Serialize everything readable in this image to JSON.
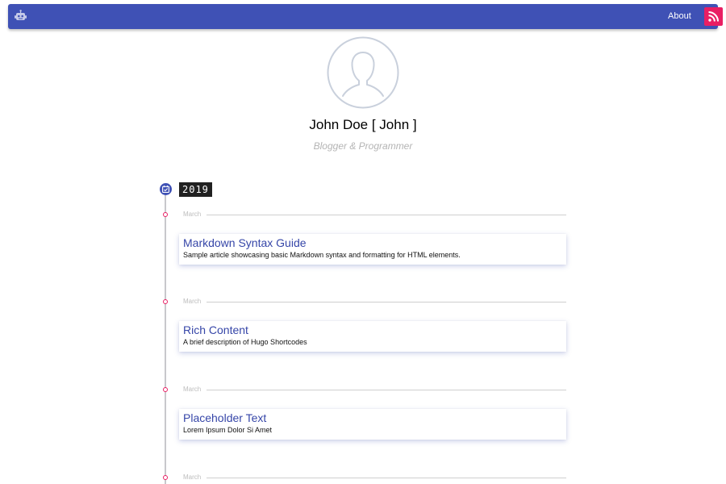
{
  "nav": {
    "brand_icon": "robot-icon",
    "about_label": "About",
    "rss_icon": "rss-icon",
    "colors": {
      "bar": "#3f51b5",
      "rss": "#e91e63"
    }
  },
  "profile": {
    "avatar_icon": "user-silhouette-icon",
    "name": "John Doe [ John ]",
    "tagline": "Blogger & Programmer"
  },
  "timeline": {
    "year_icon": "calendar-icon",
    "year": "2019",
    "entries": [
      {
        "month": "March",
        "title": "Markdown Syntax Guide",
        "description": "Sample article showcasing basic Markdown syntax and formatting for HTML elements."
      },
      {
        "month": "March",
        "title": "Rich Content",
        "description": "A brief description of Hugo Shortcodes"
      },
      {
        "month": "March",
        "title": "Placeholder Text",
        "description": "Lorem Ipsum Dolor Si Amet"
      },
      {
        "month": "March"
      }
    ]
  }
}
